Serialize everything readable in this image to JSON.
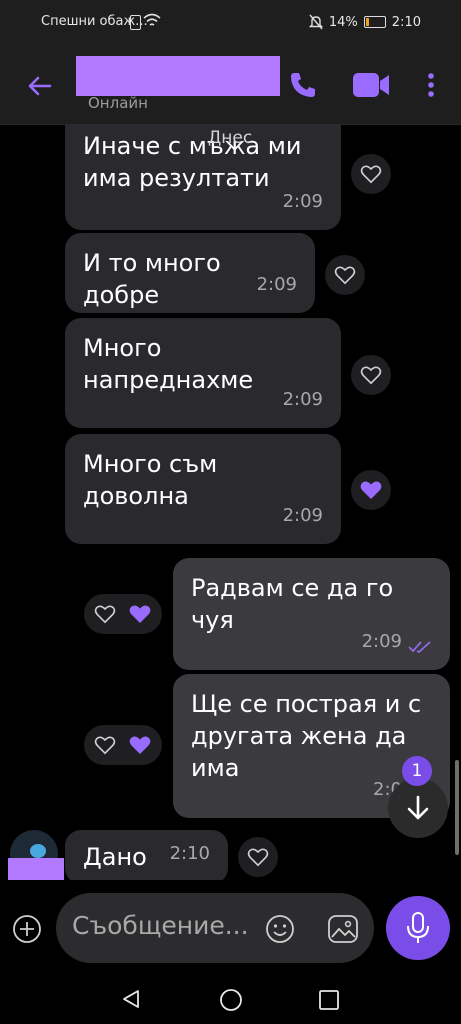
{
  "status_bar": {
    "carrier": "Спешни обаж...",
    "battery": "14%",
    "time": "2:10"
  },
  "header": {
    "presence": "Онлайн"
  },
  "date_chip": "Днес",
  "messages": [
    {
      "text": "Иначе с мъжа ми има резултати",
      "time": "2:09"
    },
    {
      "text": "И то много добре",
      "time": "2:09"
    },
    {
      "text": "Много напреднахме",
      "time": "2:09"
    },
    {
      "text": "Много съм доволна",
      "time": "2:09"
    },
    {
      "text": "Радвам се да го чуя",
      "time": "2:09"
    },
    {
      "text": "Ще се пострая и с другата жена да има",
      "time": "2:0"
    },
    {
      "text": "Дано",
      "time": "2:10"
    }
  ],
  "unread_count": "1",
  "composer": {
    "placeholder": "Съобщение..."
  },
  "colors": {
    "accent": "#7b4de8",
    "heart": "#9a6bff",
    "redaction": "#b279ff"
  }
}
